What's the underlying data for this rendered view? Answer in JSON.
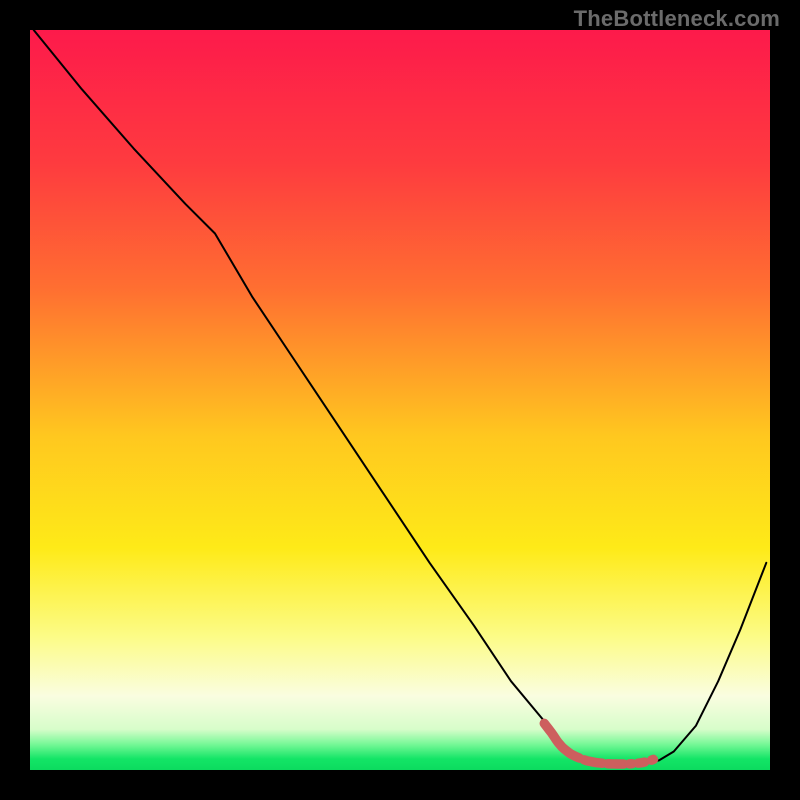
{
  "watermark": "TheBottleneck.com",
  "chart_data": {
    "type": "line",
    "title": "",
    "xlabel": "",
    "ylabel": "",
    "xlim": [
      0,
      100
    ],
    "ylim": [
      0,
      100
    ],
    "gradient_stops": [
      {
        "offset": 0.0,
        "color": "#fd1a4b"
      },
      {
        "offset": 0.18,
        "color": "#fe3b3f"
      },
      {
        "offset": 0.35,
        "color": "#ff6f31"
      },
      {
        "offset": 0.55,
        "color": "#ffc81f"
      },
      {
        "offset": 0.7,
        "color": "#feea18"
      },
      {
        "offset": 0.82,
        "color": "#fcfc87"
      },
      {
        "offset": 0.9,
        "color": "#fafde0"
      },
      {
        "offset": 0.945,
        "color": "#d7fdca"
      },
      {
        "offset": 0.965,
        "color": "#77f897"
      },
      {
        "offset": 0.985,
        "color": "#13e566"
      },
      {
        "offset": 1.0,
        "color": "#0cdb5f"
      }
    ],
    "series": [
      {
        "name": "bottleneck-curve",
        "x": [
          0.5,
          7,
          14,
          21,
          25,
          30,
          36,
          42,
          48,
          54,
          60,
          65,
          70,
          71.5,
          73,
          75,
          77,
          79,
          81,
          83,
          85,
          87,
          90,
          93,
          96,
          99.5
        ],
        "y": [
          100,
          92,
          84,
          76.5,
          72.5,
          64,
          55,
          46,
          37,
          28,
          19.5,
          12,
          6,
          3.6,
          2.2,
          1.2,
          0.9,
          0.8,
          0.8,
          0.9,
          1.3,
          2.5,
          6,
          12,
          19,
          28
        ],
        "color": "#000000",
        "width": 2.0
      },
      {
        "name": "highlight-segment",
        "x": [
          69.5,
          70.5,
          71.3,
          72.0,
          73.0,
          74.0,
          75.2,
          76.5,
          78.0,
          79.5,
          81.0,
          82.5,
          83.5,
          84.3,
          85.0
        ],
        "y": [
          6.3,
          5.0,
          3.8,
          3.0,
          2.2,
          1.7,
          1.25,
          1.0,
          0.85,
          0.8,
          0.82,
          0.95,
          1.15,
          1.45,
          1.9
        ],
        "color": "#cd5f5e",
        "width": 9.5,
        "dashed": true
      }
    ]
  }
}
